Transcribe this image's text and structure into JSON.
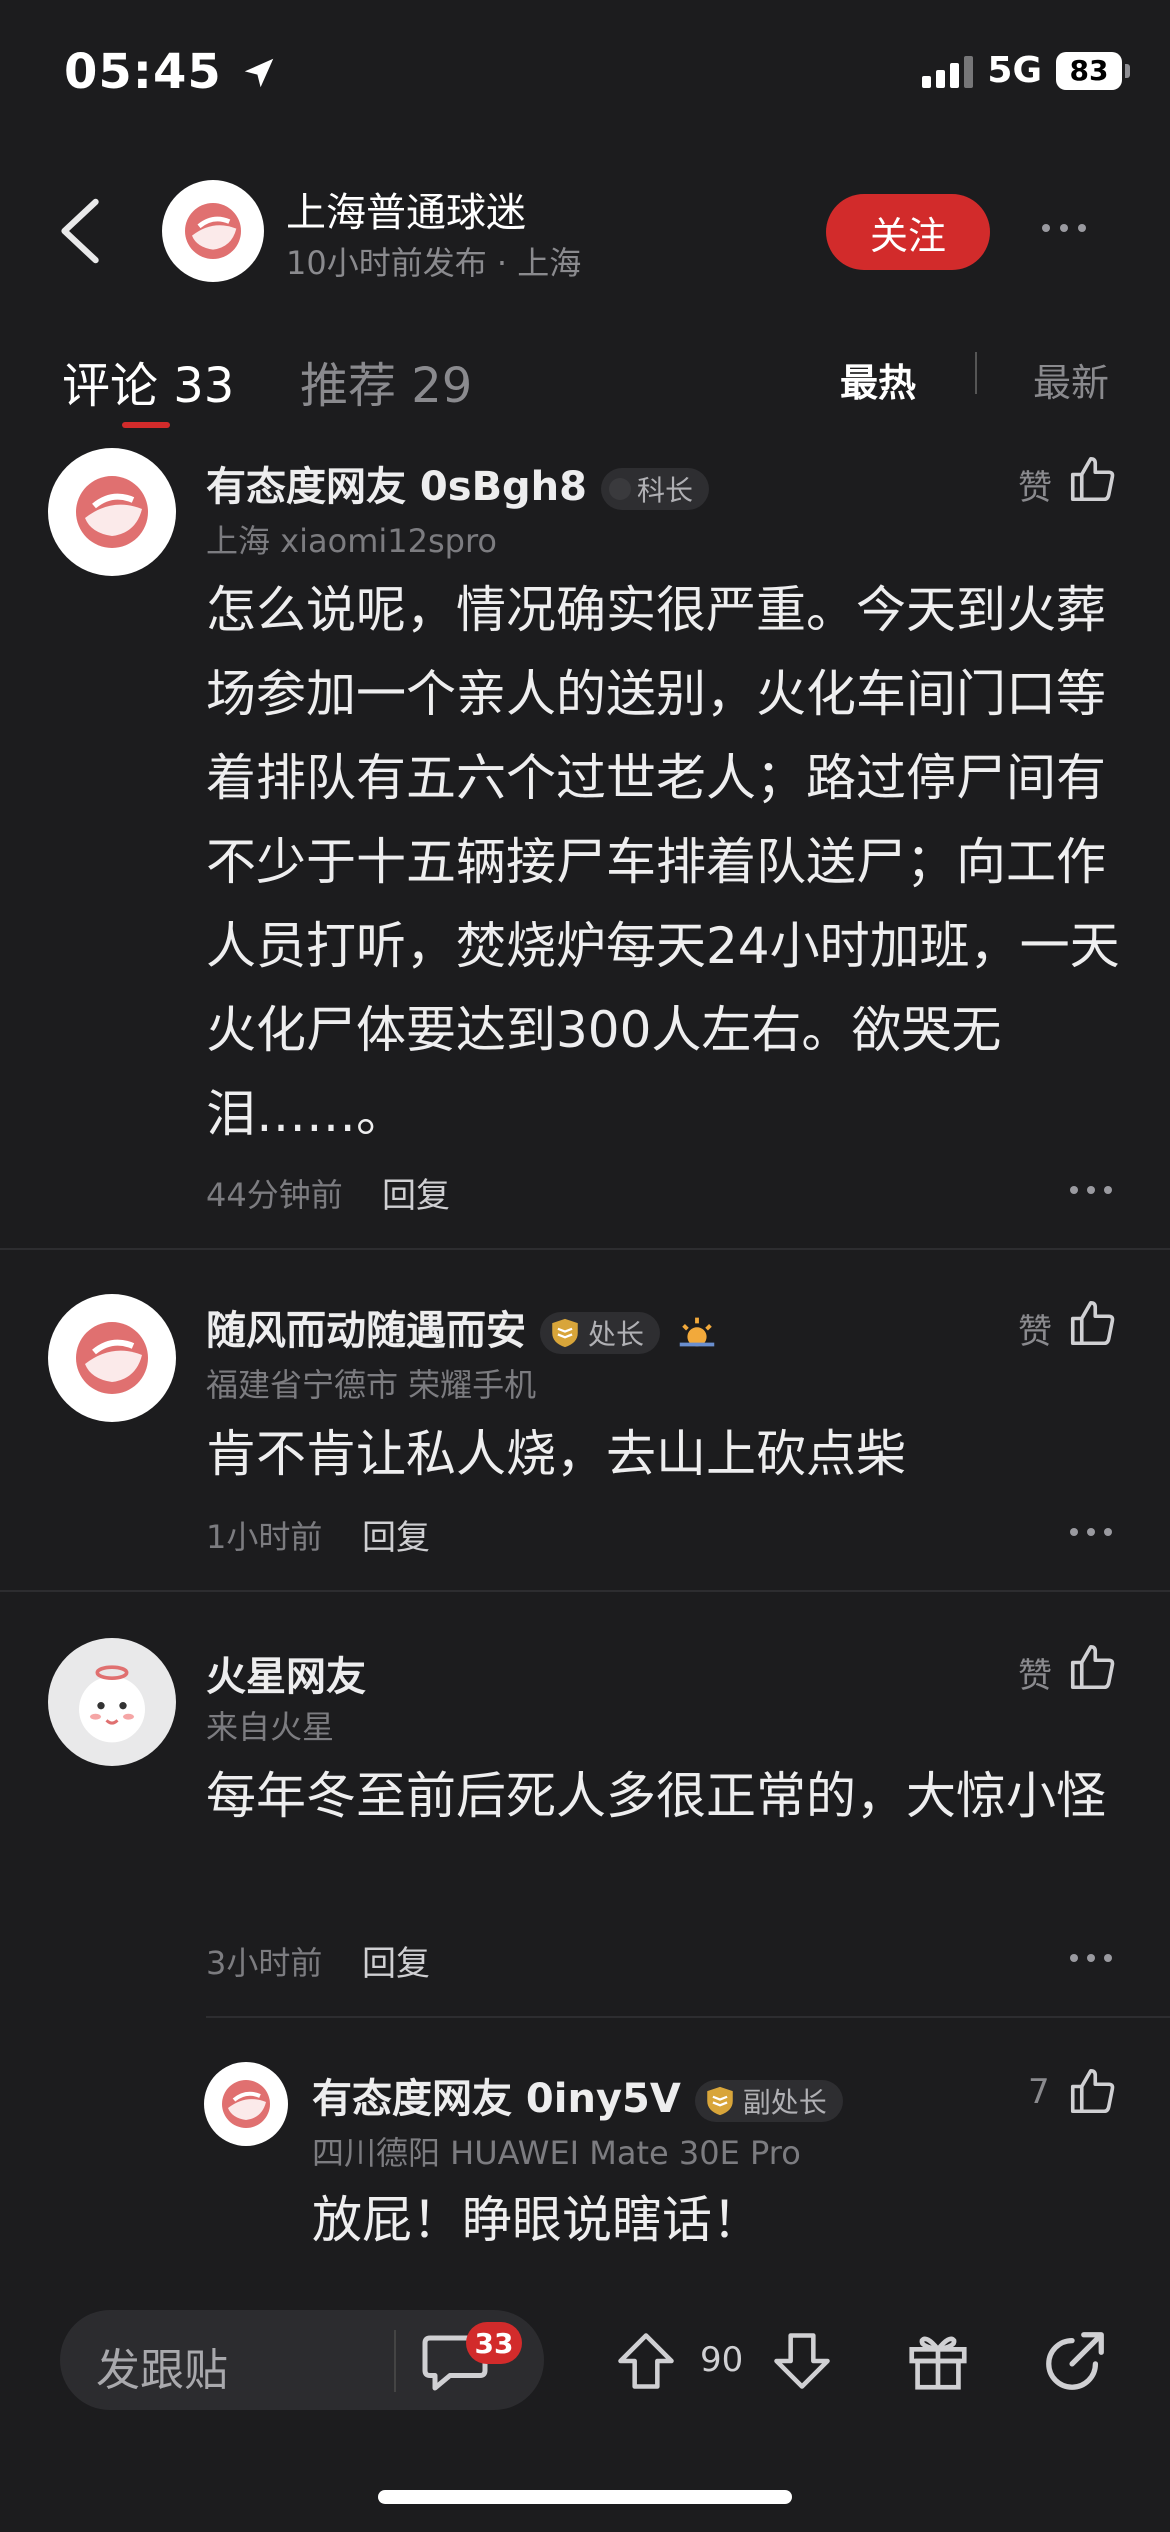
{
  "status_bar": {
    "time": "05:45",
    "network": "5G",
    "battery": "83"
  },
  "post": {
    "author": "上海普通球迷",
    "meta": "10小时前发布 · 上海",
    "follow_label": "关注"
  },
  "tabs": [
    {
      "label": "评论 33",
      "active": true
    },
    {
      "label": "推荐 29",
      "active": false
    }
  ],
  "sort": {
    "hot": "最热",
    "new": "最新"
  },
  "comments": [
    {
      "username": "有态度网友 0sBgh8",
      "badge": "科长",
      "meta": "上海 xiaomi12spro",
      "text": "怎么说呢，情况确实很严重。今天到火葬场参加一个亲人的送别，火化车间门口等着排队有五六个过世老人；路过停尸间有不少于十五辆接尸车排着队送尸；向工作人员打听，焚烧炉每天24小时加班，一天火化尸体要达到300人左右。欲哭无泪……。",
      "time": "44分钟前",
      "reply": "回复",
      "like": "赞"
    },
    {
      "username": "随风而动随遇而安",
      "badge": "处长",
      "meta": "福建省宁德市 荣耀手机",
      "text": "肯不肯让私人烧，去山上砍点柴",
      "time": "1小时前",
      "reply": "回复",
      "like": "赞"
    },
    {
      "username": "火星网友",
      "meta": "来自火星",
      "text": "每年冬至前后死人多很正常的，大惊小怪",
      "time": "3小时前",
      "reply": "回复",
      "like": "赞"
    }
  ],
  "sub_comment": {
    "username": "有态度网友 0iny5V",
    "badge": "副处长",
    "meta": "四川德阳 HUAWEI Mate 30E Pro",
    "text": "放屁！睁眼说瞎话！",
    "like": "7"
  },
  "bottom_bar": {
    "compose_placeholder": "发跟贴",
    "comment_count": "33",
    "vote_count": "90"
  },
  "colors": {
    "accent": "#d22b2b",
    "background": "#1c1c1e"
  }
}
